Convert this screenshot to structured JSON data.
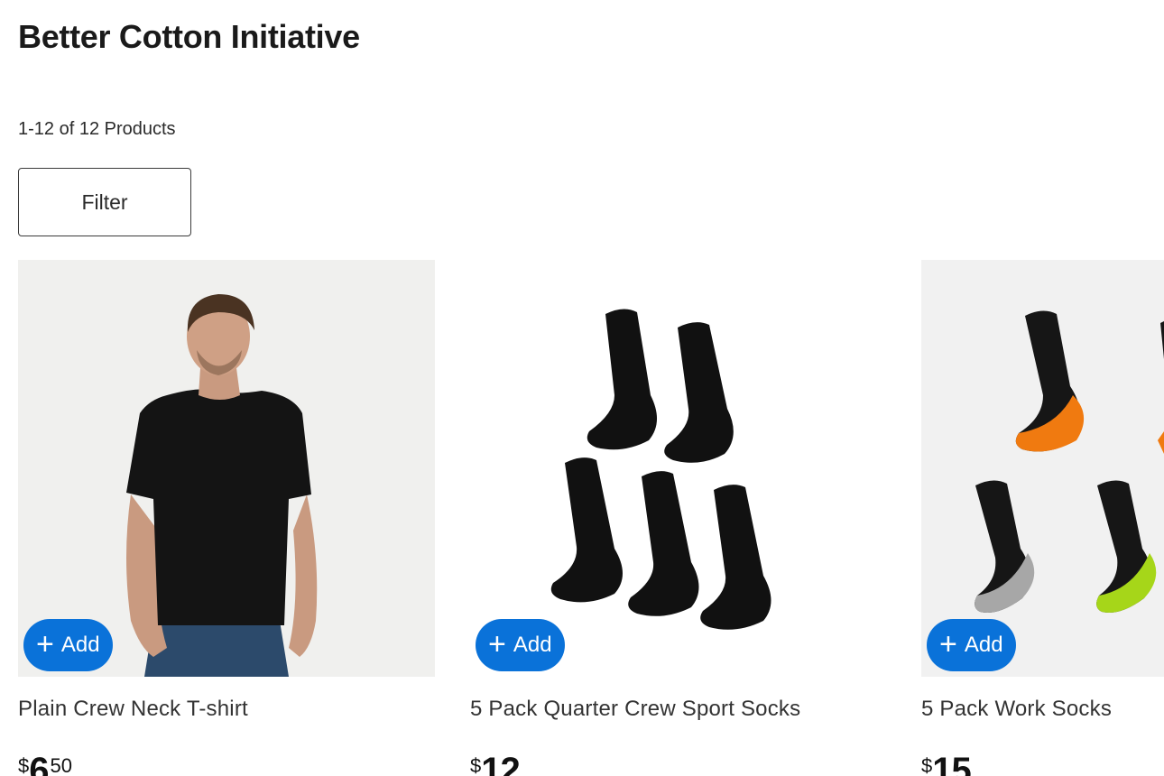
{
  "page": {
    "title": "Better Cotton Initiative",
    "result_count": "1-12 of 12 Products",
    "filter_label": "Filter"
  },
  "products": [
    {
      "name": "Plain Crew Neck T-shirt",
      "add_label": "Add",
      "price": {
        "currency": "$",
        "dollars": "6",
        "cents": "50"
      },
      "image": "man-in-black-tshirt"
    },
    {
      "name": "5 Pack Quarter Crew Sport Socks",
      "add_label": "Add",
      "price": {
        "currency": "$",
        "dollars": "12",
        "cents": ""
      },
      "image": "five-black-socks"
    },
    {
      "name": "5 Pack Work Socks",
      "add_label": "Add",
      "price": {
        "currency": "$",
        "dollars": "15",
        "cents": ""
      },
      "image": "work-socks-colored-toes"
    }
  ],
  "colors": {
    "add_button": "#0a72d9",
    "image_background": "#f1f1f1",
    "sock_accent_orange": "#f07a10",
    "sock_accent_grey": "#a7a7a7",
    "sock_accent_lime": "#a6d619"
  },
  "icons": {
    "add": "plus-icon"
  }
}
